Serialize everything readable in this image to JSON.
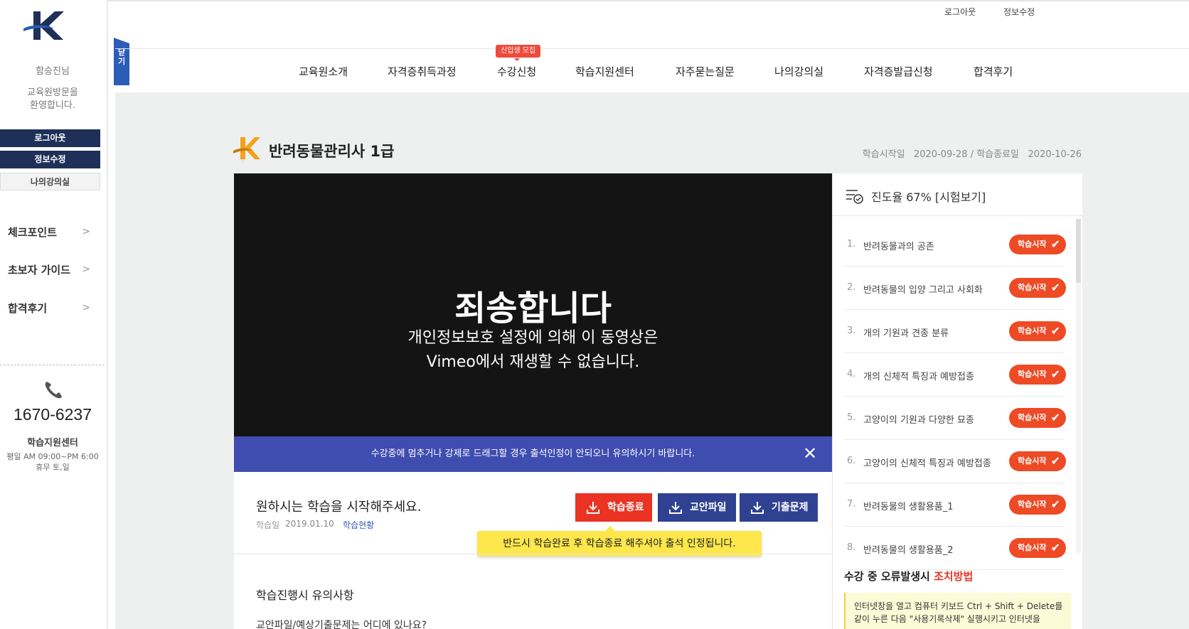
{
  "colors": {
    "navy": "#1e3058",
    "accent_blue": "#2b5db8",
    "notice_bar": "#3f4db0",
    "red": "#ea3323",
    "orange_button": "#ee4a25",
    "tooltip_yellow": "#fde74c"
  },
  "sidebar": {
    "greeting_name": "함승진님",
    "welcome_line1": "교육원방문을",
    "welcome_line2": "환영합니다.",
    "buttons": [
      "로그아웃",
      "정보수정",
      "나의강의실"
    ],
    "menu": [
      "체크포인트",
      "초보자 가이드",
      "합격후기"
    ],
    "phone": "1670-6237",
    "center_name": "학습지원센터",
    "hours_line1": "평일 AM 09:00~PM 6:00",
    "hours_line2": "휴무 토,일"
  },
  "close_tab": {
    "line1": "닫",
    "line2": "기"
  },
  "header": {
    "util_links": [
      "로그아웃",
      "정보수정"
    ],
    "nav": [
      "교육원소개",
      "자격증취득과정",
      "수강신청",
      "학습지원센터",
      "자주묻는질문",
      "나의강의실",
      "자격증발급신청",
      "합격후기"
    ],
    "nav_badge": "신입생 모집"
  },
  "course": {
    "title": "반려동물관리사 1급",
    "start_label": "학습시작일",
    "start_date": "2020-09-28",
    "end_label": "학습종료일",
    "end_date": "2020-10-26",
    "separator": "/"
  },
  "video": {
    "title": "죄송합니다",
    "message_line1": "개인정보보호 설정에 의해 이 동영상은",
    "message_line2": "Vimeo에서 재생할 수 없습니다."
  },
  "notice": {
    "text": "수강중에 멈추거나 강제로 드래그할 경우 출석인정이 안되오니 유의하시기 바랍니다.",
    "close_icon": "✕"
  },
  "lesson": {
    "heading": "원하시는 학습을 시작해주세요.",
    "date_label": "학습일",
    "date": "2019.01.10",
    "status_link": "학습현황",
    "buttons": [
      "학습종료",
      "교안파일",
      "기출문제"
    ],
    "tooltip": "반드시 학습완료 후 학습종료 해주셔야 출석 인정됩니다.",
    "caution_title": "학습진행시 유의사항",
    "caution_question": "교안파일/예상기출문제는 어디에 있나요?"
  },
  "progress": {
    "label": "진도율 67% [시험보기]",
    "value_percent": 67
  },
  "lessons": [
    {
      "num": "1.",
      "name": "반려동물과의 공존",
      "button": "학습시작"
    },
    {
      "num": "2.",
      "name": "반려동물의 입양 그리고 사회화",
      "button": "학습시작"
    },
    {
      "num": "3.",
      "name": "개의 기원과 견종 분류",
      "button": "학습시작"
    },
    {
      "num": "4.",
      "name": "개의 신체적 특징과 예방접종",
      "button": "학습시작"
    },
    {
      "num": "5.",
      "name": "고양이의 기원과 다양한 묘종",
      "button": "학습시작"
    },
    {
      "num": "6.",
      "name": "고양이의 신체적 특징과 예방접종",
      "button": "학습시작"
    },
    {
      "num": "7.",
      "name": "반려동물의 생활용품_1",
      "button": "학습시작"
    },
    {
      "num": "8.",
      "name": "반려동물의 생활용품_2",
      "button": "학습시작"
    }
  ],
  "error_help": {
    "title_prefix": "수강 중 오류발생시",
    "title_highlight": "조치방법",
    "line1": "인터넷창을 열고 컴퓨터 키보드 Ctrl + Shift + Delete를",
    "line2": "같이 누른 다음 \"사용기록삭제\" 실행시키고 인터넷을"
  }
}
